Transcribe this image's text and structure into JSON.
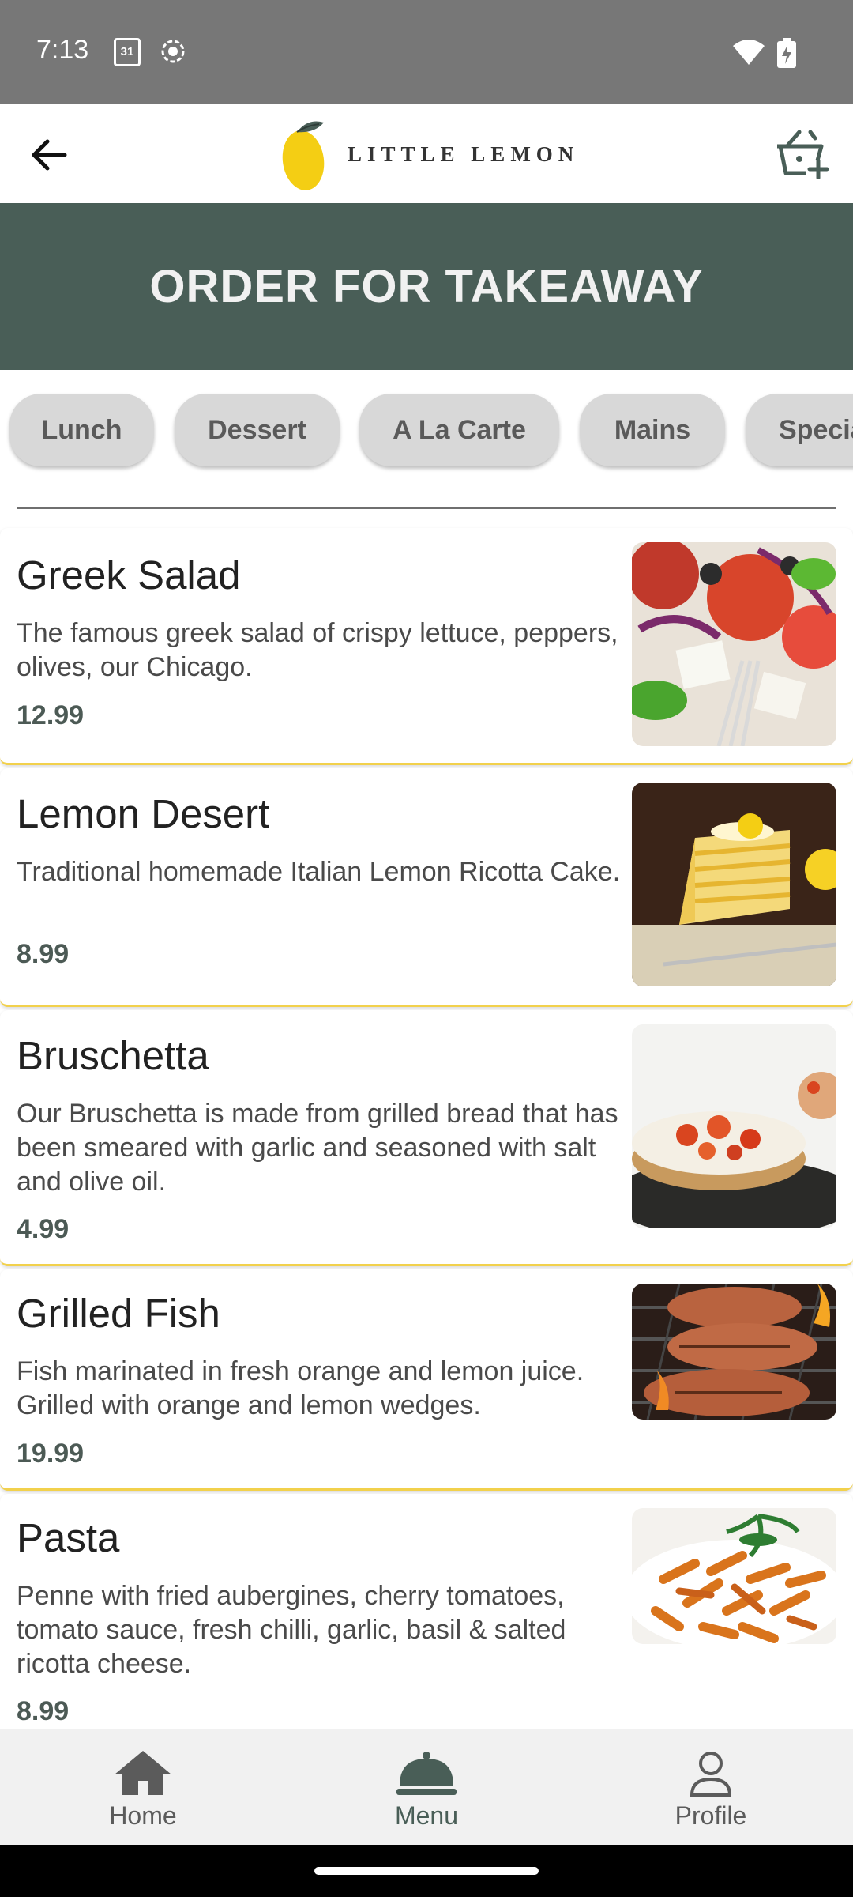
{
  "status_bar": {
    "time": "7:13",
    "calendar_day": "31",
    "icons": [
      "calendar-icon",
      "screen-record-icon",
      "wifi-icon",
      "battery-charging-icon"
    ]
  },
  "top_bar": {
    "back_icon": "arrow-back-icon",
    "logo_text": "LITTLE LEMON",
    "basket_icon": "basket-add-icon"
  },
  "hero": {
    "title": "ORDER FOR TAKEAWAY"
  },
  "categories": [
    {
      "label": "Lunch"
    },
    {
      "label": "Dessert"
    },
    {
      "label": "A La Carte"
    },
    {
      "label": "Mains"
    },
    {
      "label": "Specia"
    }
  ],
  "menu": [
    {
      "name": "Greek Salad",
      "description": "The famous greek salad of crispy lettuce, peppers, olives, our Chicago.",
      "price": "12.99",
      "image": "greek-salad-image"
    },
    {
      "name": "Lemon Desert",
      "description": "Traditional homemade Italian Lemon Ricotta Cake.",
      "price": "8.99",
      "image": "lemon-cake-image"
    },
    {
      "name": "Bruschetta",
      "description": "Our Bruschetta is made from grilled bread that has been smeared with garlic and seasoned with salt and olive oil.",
      "price": "4.99",
      "image": "bruschetta-image"
    },
    {
      "name": "Grilled Fish",
      "description": "Fish marinated in fresh orange and lemon juice. Grilled with orange and lemon wedges.",
      "price": "19.99",
      "image": "grilled-fish-image"
    },
    {
      "name": "Pasta",
      "description": "Penne with fried aubergines, cherry tomatoes, tomato sauce, fresh chilli, garlic, basil & salted ricotta cheese.",
      "price": "8.99",
      "image": "pasta-image"
    }
  ],
  "bottom_nav": [
    {
      "label": "Home",
      "icon": "home-icon"
    },
    {
      "label": "Menu",
      "icon": "cloche-icon"
    },
    {
      "label": "Profile",
      "icon": "person-icon"
    }
  ],
  "colors": {
    "primary_green": "#495e57",
    "accent_yellow": "#f4ce14",
    "divider": "#f2d14c"
  }
}
